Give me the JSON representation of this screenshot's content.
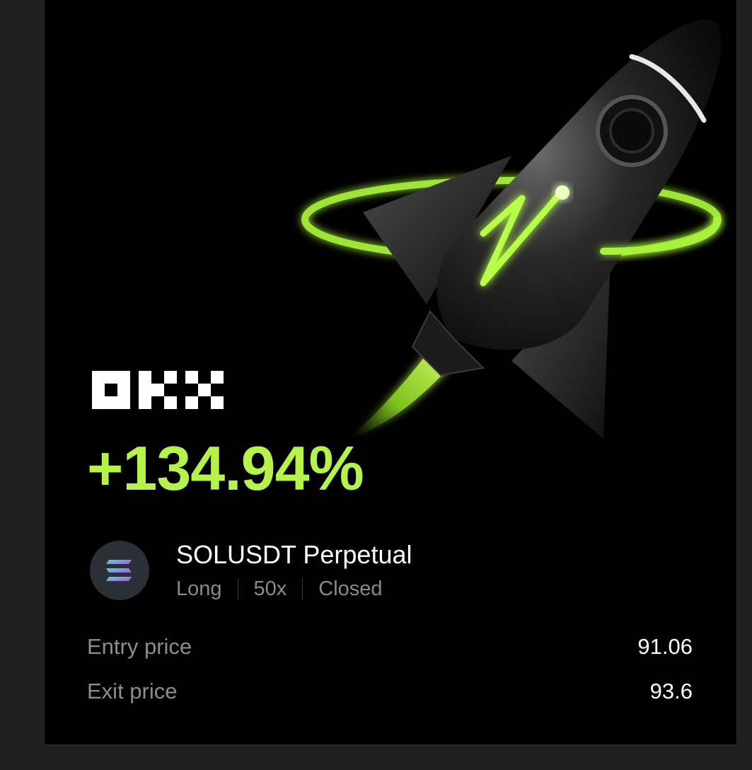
{
  "brand": "OKX",
  "pnl_percent": "+134.94%",
  "position": {
    "pair": "SOLUSDT Perpetual",
    "side": "Long",
    "leverage": "50x",
    "status": "Closed",
    "coin_icon": "solana-icon"
  },
  "prices": [
    {
      "label": "Entry price",
      "value": "91.06"
    },
    {
      "label": "Exit price",
      "value": "93.6"
    }
  ],
  "colors": {
    "accent": "#b5f34a",
    "background": "#000000"
  }
}
